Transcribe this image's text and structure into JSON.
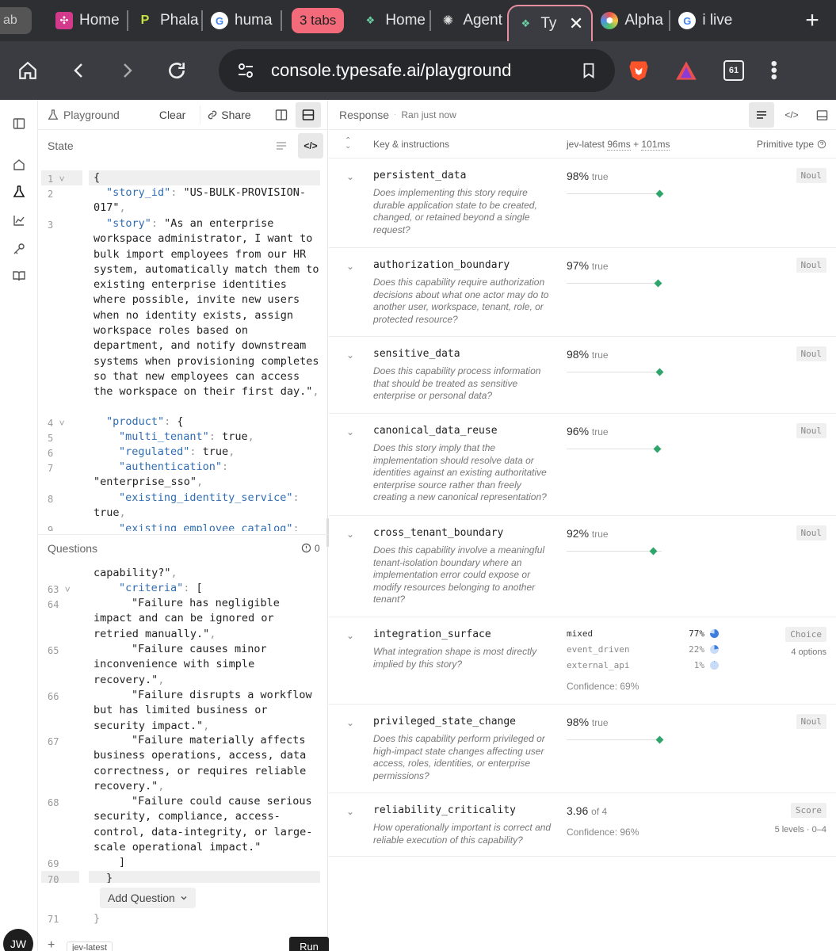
{
  "browser": {
    "tabs": [
      {
        "label": "ab",
        "icon": "tab-icon"
      },
      {
        "label": "Home",
        "icon": "perplexity-icon",
        "color": "#d43a8c"
      },
      {
        "label": "Phala",
        "icon": "phala-icon",
        "color": "#c9e23f"
      },
      {
        "label": "huma",
        "icon": "google-icon"
      },
      {
        "label": "3 tabs",
        "icon": "tab-group"
      },
      {
        "label": "Home",
        "icon": "typesafe-icon"
      },
      {
        "label": "Agent",
        "icon": "openai-icon"
      },
      {
        "label": "Ty",
        "icon": "typesafe-icon"
      },
      {
        "label": "Alpha",
        "icon": "alpha-icon"
      },
      {
        "label": "i live",
        "icon": "google-icon"
      }
    ],
    "url": "console.typesafe.ai/playground",
    "tab_count": "61"
  },
  "user": {
    "initials": "JW"
  },
  "left_pane": {
    "title": "Playground",
    "clear_label": "Clear",
    "share_label": "Share",
    "state_label": "State",
    "questions_label": "Questions",
    "questions_count": "0",
    "add_question_label": "Add Question",
    "model_label": "jev-latest",
    "run_label": "Run"
  },
  "state_lines": [
    {
      "n": "1",
      "text": "{"
    },
    {
      "n": "2",
      "text": "\"story_id\": \"US-BULK-PROVISION-017\","
    },
    {
      "n": "3",
      "text": "\"story\": \"As an enterprise workspace administrator, I want to bulk import employees from our HR system, automatically match them to existing enterprise identities where possible, invite new users when no identity exists, assign workspace roles based on department, and notify downstream systems when provisioning completes so that new employees can access the workspace on their first day.\","
    },
    {
      "n": "4",
      "text": "\"product\": {"
    },
    {
      "n": "5",
      "text": "\"multi_tenant\": true,"
    },
    {
      "n": "6",
      "text": "\"regulated\": true,"
    },
    {
      "n": "7",
      "text": "\"authentication\": \"enterprise_sso\","
    },
    {
      "n": "8",
      "text": "\"existing_identity_service\": true,"
    },
    {
      "n": "9",
      "text": "\"existing_employee_catalog\":"
    }
  ],
  "question_lines": [
    {
      "n": "",
      "text": "capability?\","
    },
    {
      "n": "63",
      "text": "\"criteria\": ["
    },
    {
      "n": "64",
      "text": "\"Failure has negligible impact and can be ignored or retried manually.\","
    },
    {
      "n": "65",
      "text": "\"Failure causes minor inconvenience with simple recovery.\","
    },
    {
      "n": "66",
      "text": "\"Failure disrupts a workflow but has limited business or security impact.\","
    },
    {
      "n": "67",
      "text": "\"Failure materially affects business operations, access, data correctness, or requires reliable recovery.\","
    },
    {
      "n": "68",
      "text": "\"Failure could cause serious security, compliance, access-control, data-integrity, or large-scale operational impact.\""
    },
    {
      "n": "69",
      "text": "]"
    },
    {
      "n": "70",
      "text": "}"
    },
    {
      "n": "71",
      "text": "}"
    }
  ],
  "right_pane": {
    "title": "Response",
    "status": "Ran just now",
    "col_key": "Key & instructions",
    "col_model": "jev-latest",
    "col_timing": "96ms",
    "col_plus": "+",
    "col_timing2": "101ms",
    "col_type": "Primitive type",
    "rows": [
      {
        "name": "persistent_data",
        "desc": "Does implementing this story require durable application state to be created, changed, or retained beyond a single request?",
        "pct": "98%",
        "val": "true",
        "badge": "Noul",
        "frac": 0.98
      },
      {
        "name": "authorization_boundary",
        "desc": "Does this capability require authorization decisions about what one actor may do to another user, workspace, tenant, role, or protected resource?",
        "pct": "97%",
        "val": "true",
        "badge": "Noul",
        "frac": 0.97
      },
      {
        "name": "sensitive_data",
        "desc": "Does this capability process information that should be treated as sensitive enterprise or personal data?",
        "pct": "98%",
        "val": "true",
        "badge": "Noul",
        "frac": 0.98
      },
      {
        "name": "canonical_data_reuse",
        "desc": "Does this story imply that the implementation should resolve data or identities against an existing authoritative enterprise source rather than freely creating a new canonical representation?",
        "pct": "96%",
        "val": "true",
        "badge": "Noul",
        "frac": 0.96
      },
      {
        "name": "cross_tenant_boundary",
        "desc": "Does this capability involve a meaningful tenant-isolation boundary where an implementation error could expose or modify resources belonging to another tenant?",
        "pct": "92%",
        "val": "true",
        "badge": "Noul",
        "frac": 0.92
      }
    ],
    "integration": {
      "name": "integration_surface",
      "desc": "What integration shape is most directly implied by this story?",
      "options": [
        {
          "label": "mixed",
          "pct": "77%"
        },
        {
          "label": "event_driven",
          "pct": "22%"
        },
        {
          "label": "external_api",
          "pct": "1%"
        }
      ],
      "confidence": "Confidence: 69%",
      "badge": "Choice",
      "sub": "4 options"
    },
    "privileged": {
      "name": "privileged_state_change",
      "desc": "Does this capability perform privileged or high-impact state changes affecting user access, roles, identities, or enterprise permissions?",
      "pct": "98%",
      "val": "true",
      "badge": "Noul",
      "frac": 0.98
    },
    "reliability": {
      "name": "reliability_criticality",
      "desc": "How operationally important is correct and reliable execution of this capability?",
      "score": "3.96",
      "of": "of 4",
      "confidence": "Confidence: 96%",
      "badge": "Score",
      "sub": "5 levels · 0–4"
    }
  }
}
